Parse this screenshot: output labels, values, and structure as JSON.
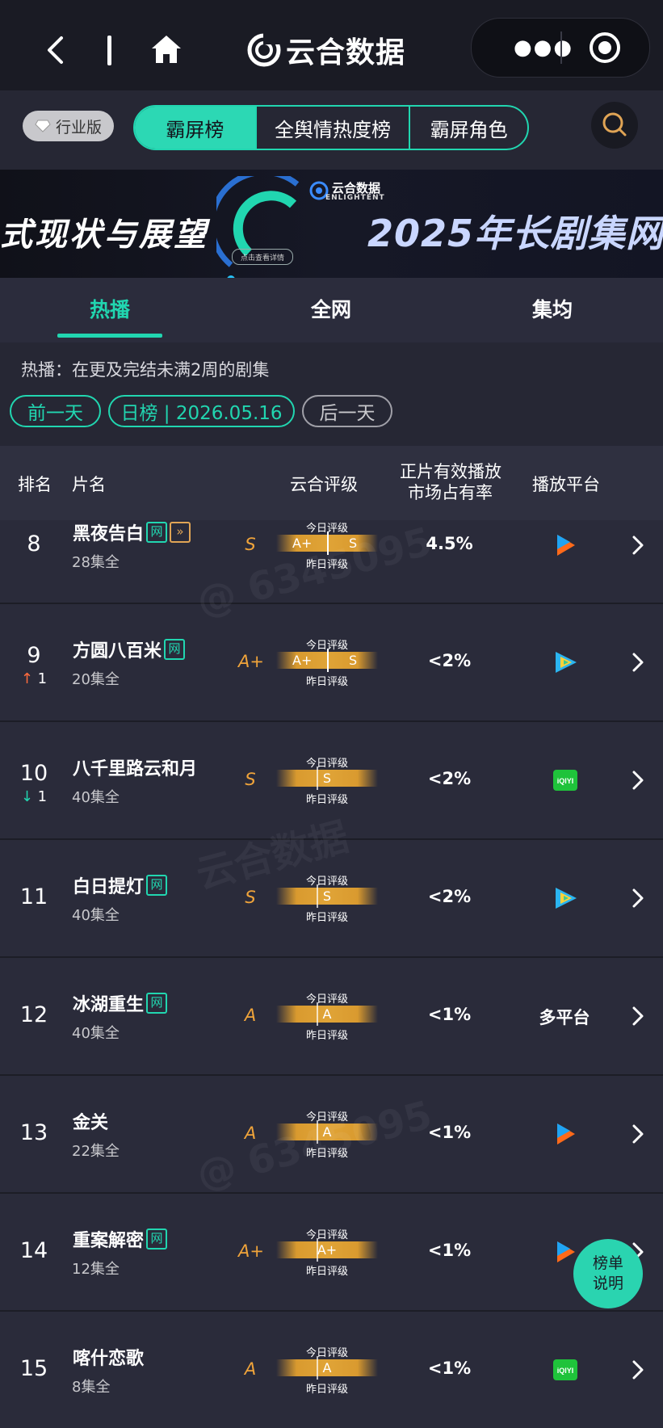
{
  "app": {
    "title": "云合数据"
  },
  "filter": {
    "industry_label": "行业版",
    "tabs": [
      {
        "label": "霸屏榜",
        "active": true
      },
      {
        "label": "全舆情热度榜",
        "active": false
      },
      {
        "label": "霸屏角色",
        "active": false
      }
    ]
  },
  "banner": {
    "left_text": "式现状与展望",
    "right_text": "2025年长剧集网",
    "logo_name": "云合数据",
    "logo_sub": "ENLIGHTENT",
    "cta": "点击查看详情"
  },
  "subtabs": [
    {
      "label": "热播",
      "active": true
    },
    {
      "label": "全网",
      "active": false
    },
    {
      "label": "集均",
      "active": false
    }
  ],
  "info": {
    "description": "热播：在更及完结未满2周的剧集",
    "prev_day": "前一天",
    "current": "日榜 | 2026.05.16",
    "next_day": "后一天"
  },
  "table": {
    "headers": {
      "rank": "排名",
      "title": "片名",
      "rating": "云合评级",
      "share_line1": "正片有效播放",
      "share_line2": "市场占有率",
      "platform": "播放平台"
    },
    "today_label": "今日评级",
    "yesterday_label": "昨日评级",
    "rows": [
      {
        "rank": "8",
        "change": "",
        "title": "黑夜告白",
        "tags": [
          "网",
          "ff"
        ],
        "episodes": "28集全",
        "grade": "S",
        "today": "A+",
        "yesterday": "S",
        "split": true,
        "share": "4.5%",
        "platform": "tencent-video",
        "platform_text": ""
      },
      {
        "rank": "9",
        "change": "1",
        "direction": "up",
        "title": "方圆八百米",
        "tags": [
          "网"
        ],
        "episodes": "20集全",
        "grade": "A+",
        "today": "A+",
        "yesterday": "S",
        "split": true,
        "share": "<2%",
        "platform": "tencent-play",
        "platform_text": ""
      },
      {
        "rank": "10",
        "change": "1",
        "direction": "down",
        "title": "八千里路云和月",
        "tags": [],
        "episodes": "40集全",
        "grade": "S",
        "today": "S",
        "yesterday": "S",
        "split": false,
        "share": "<2%",
        "platform": "iqiyi",
        "platform_text": ""
      },
      {
        "rank": "11",
        "change": "",
        "title": "白日提灯",
        "tags": [
          "网"
        ],
        "episodes": "40集全",
        "grade": "S",
        "today": "S",
        "yesterday": "S",
        "split": false,
        "share": "<2%",
        "platform": "tencent-play",
        "platform_text": ""
      },
      {
        "rank": "12",
        "change": "",
        "title": "冰湖重生",
        "tags": [
          "网"
        ],
        "episodes": "40集全",
        "grade": "A",
        "today": "A",
        "yesterday": "A",
        "split": false,
        "share": "<1%",
        "platform": "",
        "platform_text": "多平台"
      },
      {
        "rank": "13",
        "change": "",
        "title": "金关",
        "tags": [],
        "episodes": "22集全",
        "grade": "A",
        "today": "A",
        "yesterday": "A",
        "split": false,
        "share": "<1%",
        "platform": "tencent-video",
        "platform_text": ""
      },
      {
        "rank": "14",
        "change": "",
        "title": "重案解密",
        "tags": [
          "网"
        ],
        "episodes": "12集全",
        "grade": "A+",
        "today": "A+",
        "yesterday": "A+",
        "split": false,
        "share": "<1%",
        "platform": "tencent-video",
        "platform_text": ""
      },
      {
        "rank": "15",
        "change": "",
        "title": "喀什恋歌",
        "tags": [],
        "episodes": "8集全",
        "grade": "A",
        "today": "A",
        "yesterday": "A",
        "split": false,
        "share": "<1%",
        "platform": "iqiyi",
        "platform_text": ""
      }
    ]
  },
  "watermark": {
    "brand": "云合数据",
    "id": "@ 6345095"
  },
  "fab": {
    "line1": "榜单",
    "line2": "说明"
  },
  "colors": {
    "accent": "#21d6b0",
    "grade": "#f0a43a",
    "up": "#ff6b3d",
    "down": "#21d6b0",
    "background": "#1c1d26"
  }
}
